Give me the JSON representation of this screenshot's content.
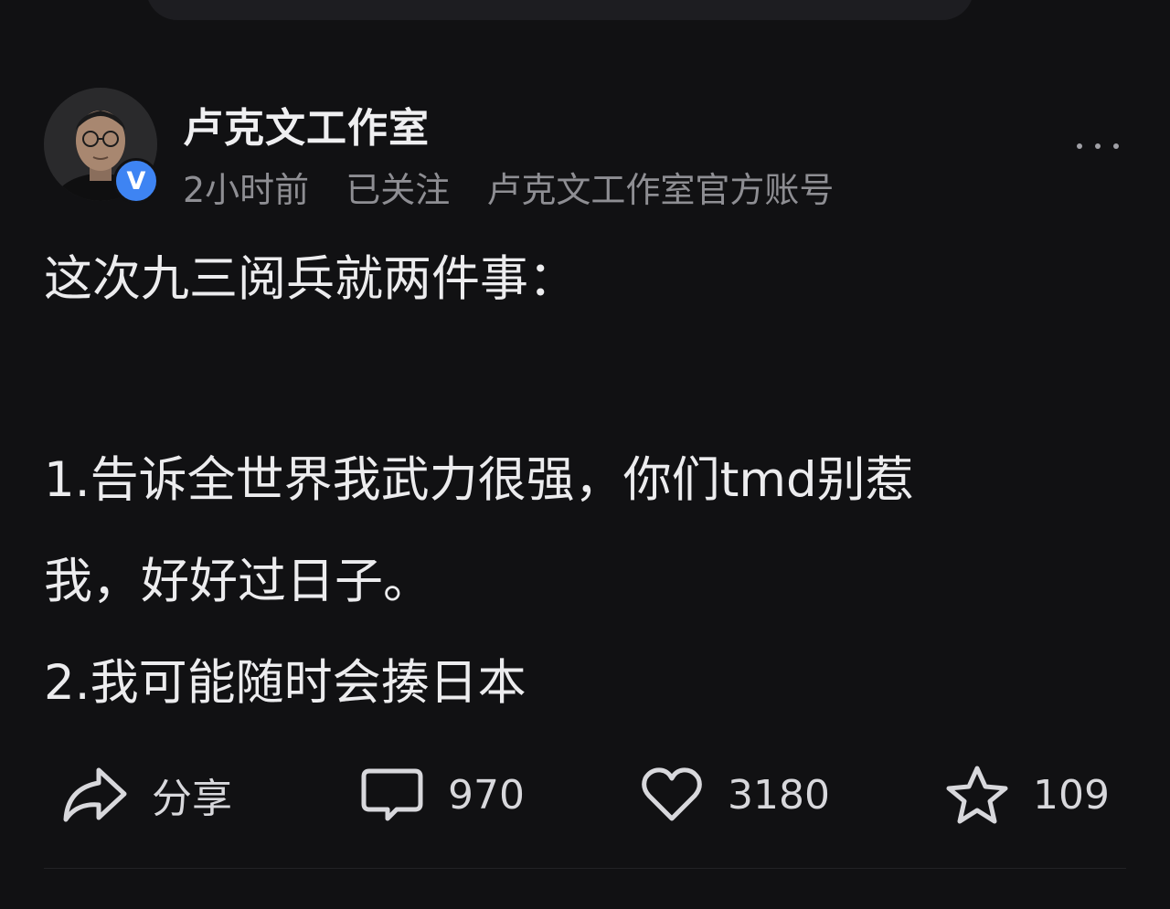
{
  "post": {
    "author_name": "卢克文工作室",
    "verified_badge": "V",
    "time": "2小时前",
    "follow_status": "已关注",
    "account_desc": "卢克文工作室官方账号",
    "body_lines": [
      "这次九三阅兵就两件事：",
      "1.告诉全世界我武力很强，你们tmd别惹",
      "我，好好过日子。",
      "2.我可能随时会揍日本"
    ]
  },
  "actions": {
    "share_label": "分享",
    "comment_count": "970",
    "like_count": "3180",
    "favorite_count": "109"
  },
  "icons": {
    "more": "more-icon",
    "share": "share-arrow-icon",
    "comment": "comment-bubble-icon",
    "like": "heart-icon",
    "favorite": "star-icon"
  },
  "colors": {
    "background": "#111113",
    "verified": "#3e84f3",
    "secondary_text": "#8e8e93"
  }
}
